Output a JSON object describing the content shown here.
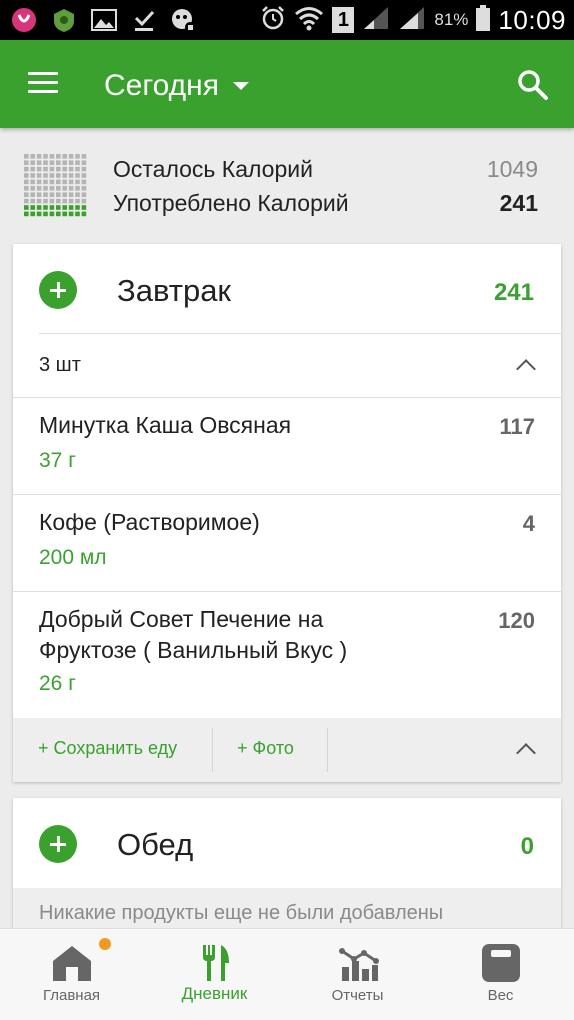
{
  "status_bar": {
    "battery": "81%",
    "time": "10:09",
    "sim": "1"
  },
  "toolbar": {
    "date": "Сегодня"
  },
  "summary": {
    "remaining_label": "Осталось Калорий",
    "remaining_value": "1049",
    "consumed_label": "Употреблено Калорий",
    "consumed_value": "241"
  },
  "breakfast": {
    "name": "Завтрак",
    "total": "241",
    "count": "3 шт",
    "items": [
      {
        "name": "Минутка Каша Овсяная",
        "qty": "37  г",
        "cal": "117"
      },
      {
        "name": "Кофе (Растворимое)",
        "qty": "200 мл",
        "cal": "4"
      },
      {
        "name": "Добрый Совет Печение на Фруктозе  ( Ванильный Вкус )",
        "qty": "26  г",
        "cal": "120"
      }
    ],
    "save_food": "+ Сохранить еду",
    "photo": "+ Фото"
  },
  "lunch": {
    "name": "Обед",
    "total": "0",
    "empty_message": "Никакие продукты еще не были добавлены"
  },
  "bottom_nav": [
    {
      "label": "Главная",
      "icon": "home-icon"
    },
    {
      "label": "Дневник",
      "icon": "cutlery-icon"
    },
    {
      "label": "Отчеты",
      "icon": "chart-icon"
    },
    {
      "label": "Вес",
      "icon": "scale-icon"
    }
  ],
  "colors": {
    "primary": "#3aa12f",
    "notification_dot": "#f39a1e",
    "background": "#ececec"
  }
}
